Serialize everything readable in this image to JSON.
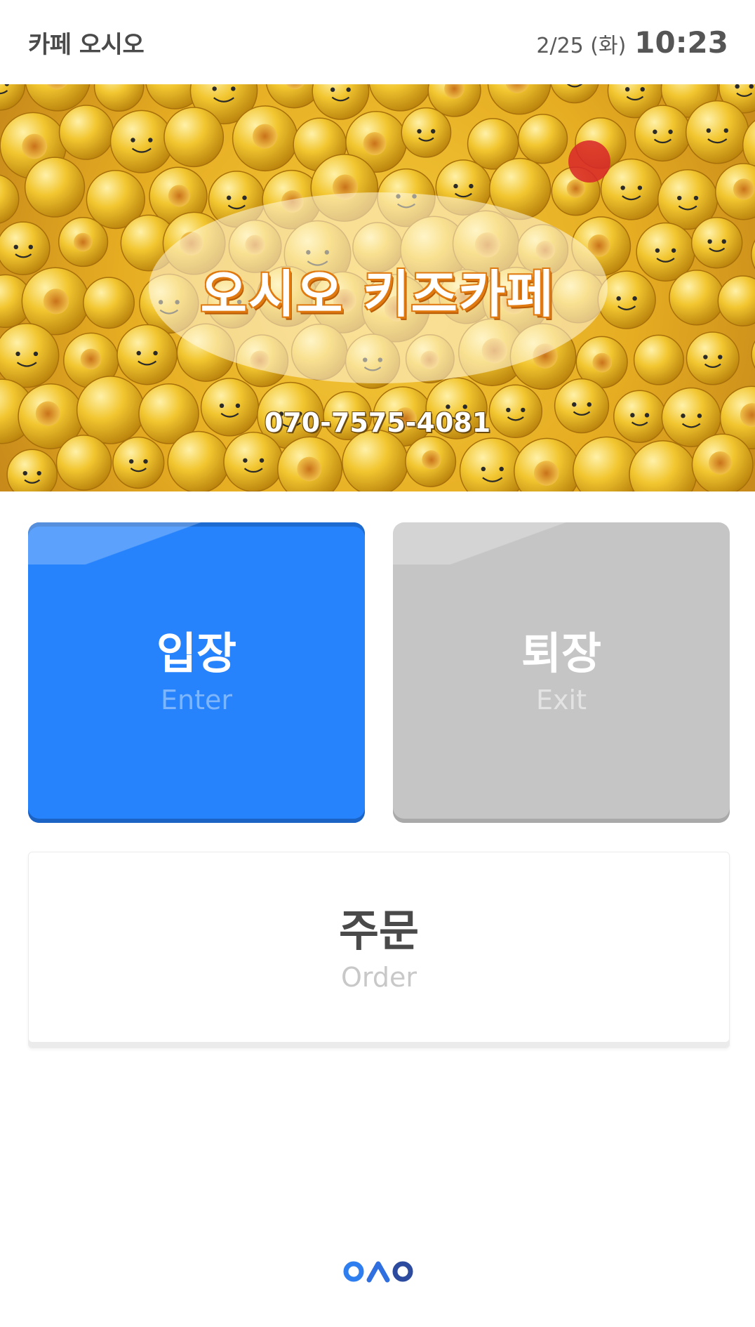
{
  "header": {
    "brand": "카페 오시오",
    "date": "2/25 (화)",
    "time": "10:23"
  },
  "banner": {
    "title": "오시오 키즈카페",
    "phone": "070-7575-4081"
  },
  "buttons": {
    "enter": {
      "label": "입장",
      "sub": "Enter",
      "color": "#2683fc"
    },
    "exit": {
      "label": "퇴장",
      "sub": "Exit",
      "color": "#c5c5c5"
    },
    "order": {
      "label": "주문",
      "sub": "Order"
    }
  },
  "footer": {
    "logo_icon": "oao-logo-icon",
    "logo_colors": [
      "#2e7ef0",
      "#2f5fc2",
      "#2c4a9e"
    ]
  }
}
